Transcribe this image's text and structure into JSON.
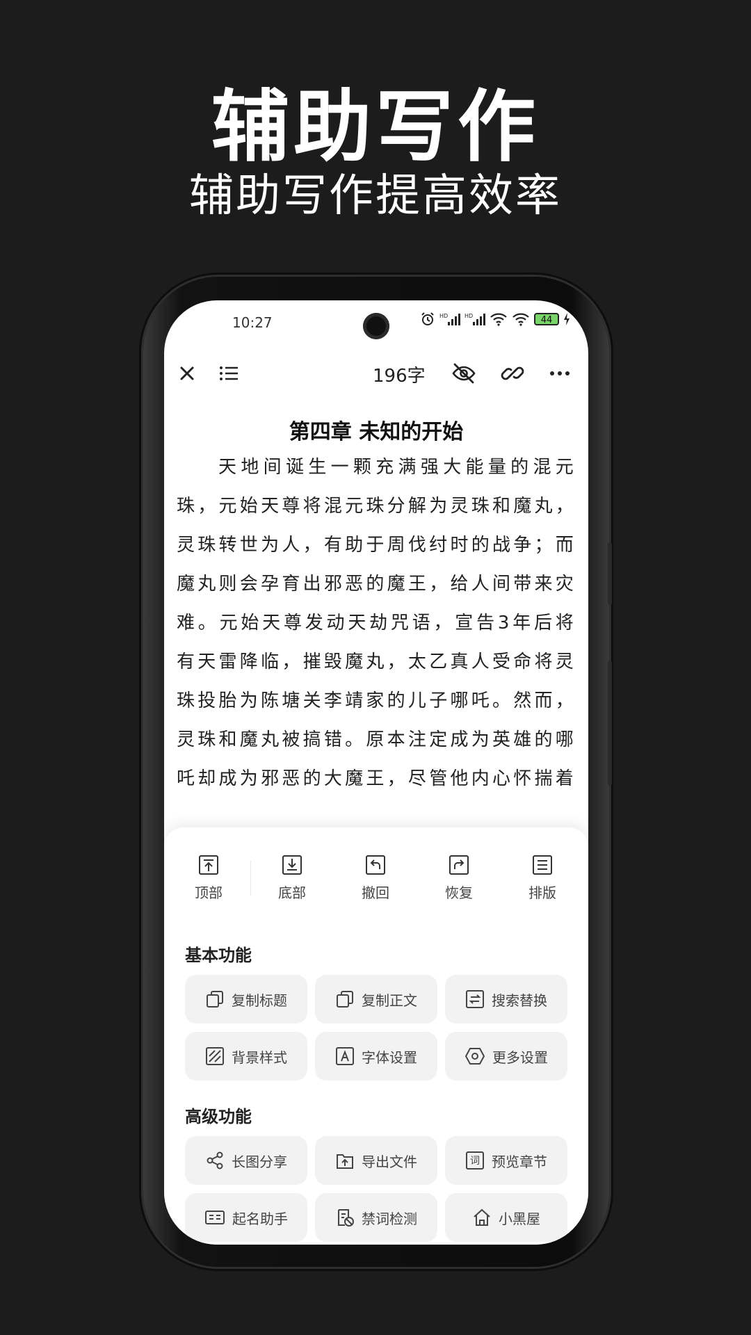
{
  "promo": {
    "title": "辅助写作",
    "subtitle": "辅助写作提高效率"
  },
  "status_bar": {
    "time": "10:27",
    "battery": "44",
    "signal_badges": [
      "HD",
      "HD"
    ]
  },
  "toolbar": {
    "word_count": "196字",
    "icons": [
      "close-icon",
      "list-icon",
      "eye-off-icon",
      "link-icon",
      "more-icon"
    ]
  },
  "document": {
    "chapter_title": "第四章 未知的开始",
    "body": "天地间诞生一颗充满强大能量的混元珠，元始天尊将混元珠分解为灵珠和魔丸，灵珠转世为人，有助于周伐纣时的战争；而魔丸则会孕育出邪恶的魔王，给人间带来灾难。元始天尊发动天劫咒语，宣告3年后将有天雷降临，摧毁魔丸，太乙真人受命将灵珠投胎为陈塘关李靖家的儿子哪吒。然而，灵珠和魔丸被搞错。原本注定成为英雄的哪吒却成为邪恶的大魔王，尽管他内心怀揣着英雄梦想"
  },
  "sheet": {
    "quick_actions": [
      {
        "label": "顶部",
        "icon": "scroll-top-icon"
      },
      {
        "label": "底部",
        "icon": "scroll-bottom-icon"
      },
      {
        "label": "撤回",
        "icon": "undo-icon"
      },
      {
        "label": "恢复",
        "icon": "redo-icon"
      },
      {
        "label": "排版",
        "icon": "format-icon"
      }
    ],
    "basic": {
      "title": "基本功能",
      "items": [
        {
          "label": "复制标题",
          "icon": "copy-icon"
        },
        {
          "label": "复制正文",
          "icon": "copy-icon"
        },
        {
          "label": "搜索替换",
          "icon": "replace-icon"
        },
        {
          "label": "背景样式",
          "icon": "background-icon"
        },
        {
          "label": "字体设置",
          "icon": "font-icon"
        },
        {
          "label": "更多设置",
          "icon": "settings-icon"
        }
      ]
    },
    "advanced": {
      "title": "高级功能",
      "items": [
        {
          "label": "长图分享",
          "icon": "share-icon"
        },
        {
          "label": "导出文件",
          "icon": "export-icon"
        },
        {
          "label": "预览章节",
          "icon": "preview-icon"
        },
        {
          "label": "起名助手",
          "icon": "name-card-icon"
        },
        {
          "label": "禁词检测",
          "icon": "banned-word-icon"
        },
        {
          "label": "小黑屋",
          "icon": "house-icon"
        }
      ]
    }
  }
}
